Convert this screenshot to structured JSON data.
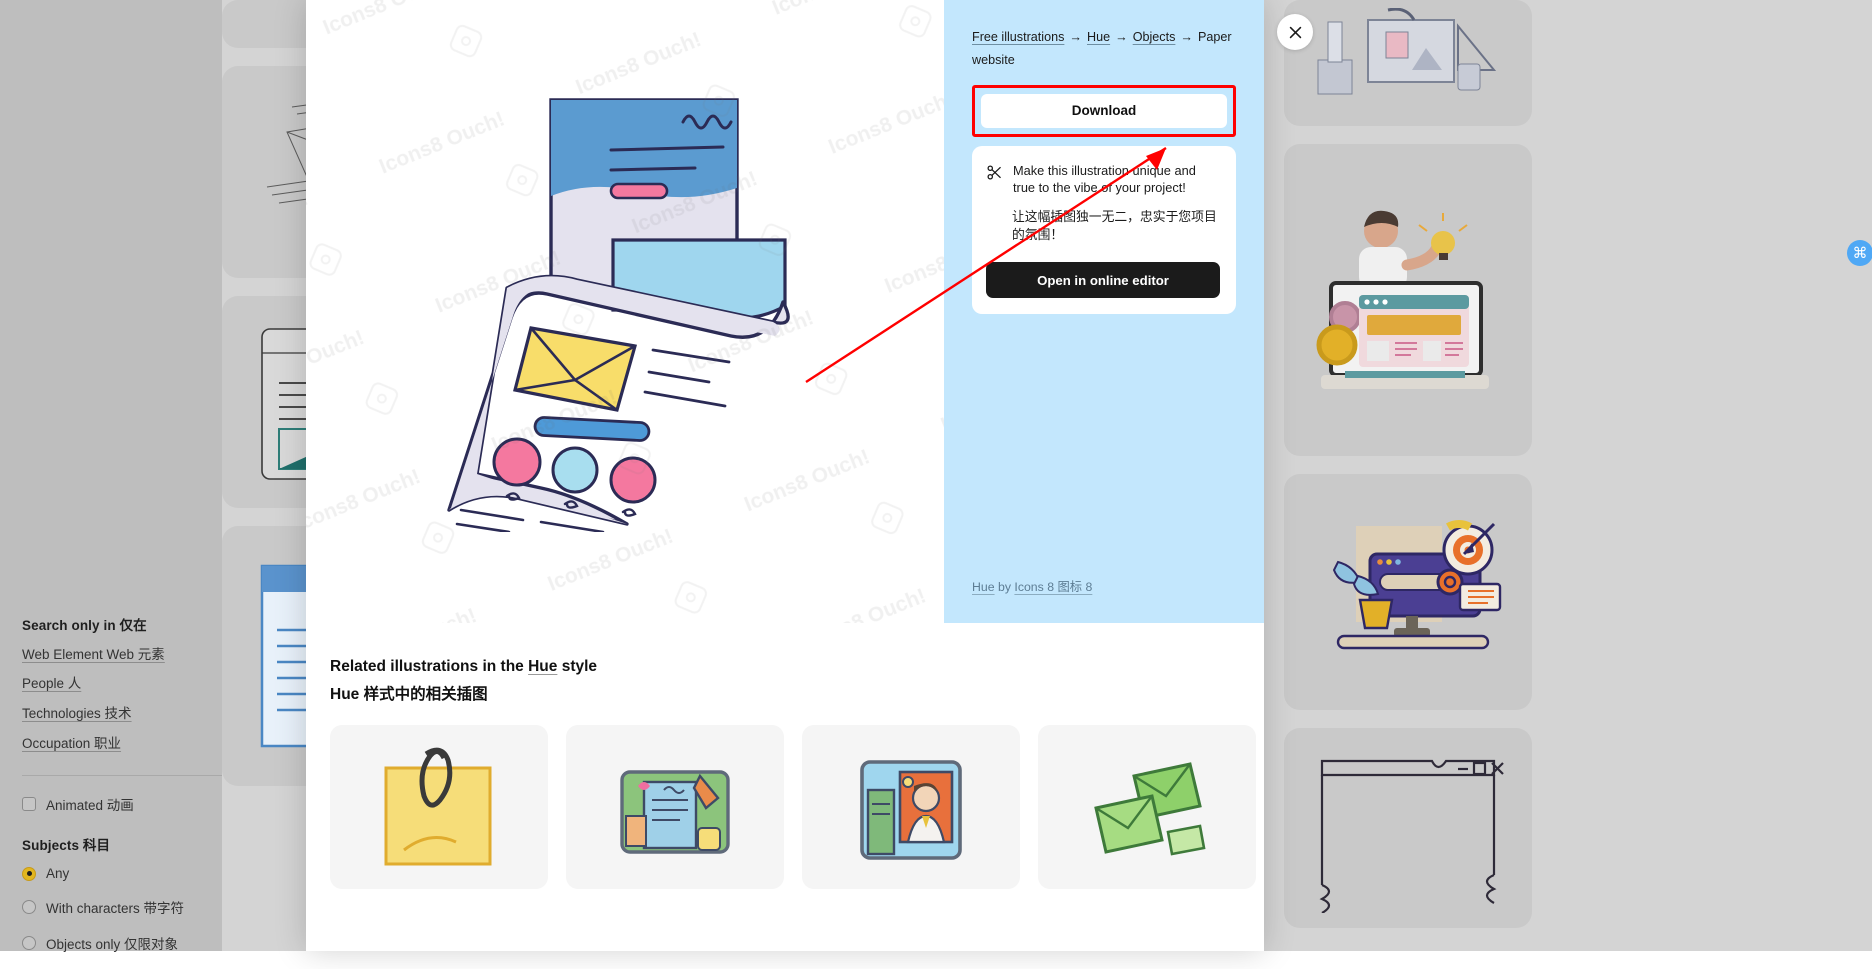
{
  "sidebar": {
    "search_only_heading": "Search only in 仅在",
    "links": [
      {
        "label": "Web Element Web 元素",
        "name": "filter-link-web-element"
      },
      {
        "label": "People 人",
        "name": "filter-link-people"
      },
      {
        "label": "Technologies 技术",
        "name": "filter-link-technologies"
      },
      {
        "label": "Occupation 职业",
        "name": "filter-link-occupation"
      }
    ],
    "animated_label": "Animated 动画",
    "animated_checked": false,
    "subjects_heading": "Subjects 科目",
    "subjects": [
      {
        "label": "Any",
        "selected": true
      },
      {
        "label": "With characters 带字符",
        "selected": false
      },
      {
        "label": "Objects only 仅限对象",
        "selected": false
      }
    ]
  },
  "modal": {
    "breadcrumb": {
      "items": [
        "Free illustrations",
        "Hue",
        "Objects"
      ],
      "separator": "→",
      "current": "Paper website"
    },
    "download_label": "Download",
    "promo": {
      "icon": "scissors-icon",
      "text_en": "Make this illustration unique and true to the vibe of your project!",
      "text_zh": "让这幅插图独一无二，忠实于您项目的氛围！",
      "button_label": "Open in online editor"
    },
    "attribution": {
      "style": "Hue",
      "by": "by",
      "author": "Icons 8 图标 8"
    },
    "illustration": {
      "name": "paper-website-illustration",
      "watermark": "Icons8 Ouch!"
    },
    "related": {
      "title_en_a": "Related illustrations in the ",
      "title_en_style": "Hue",
      "title_en_b": " style",
      "title_zh": "Hue 样式中的相关插图",
      "cards": [
        {
          "name": "related-card-sticky-note"
        },
        {
          "name": "related-card-tablet-notes"
        },
        {
          "name": "related-card-profile-screen"
        },
        {
          "name": "related-card-envelopes"
        }
      ]
    },
    "close_label": "×"
  },
  "overlay": {
    "annotation_color": "#ff0000",
    "cmd_badge": "⌘"
  },
  "background_cards": {
    "left": [
      {
        "name": "bg-card-envelope-sketch"
      },
      {
        "name": "bg-card-document-teal"
      },
      {
        "name": "bg-card-blue-page"
      }
    ],
    "right": [
      {
        "name": "bg-card-greyscale-studio"
      },
      {
        "name": "bg-card-laptop-idea"
      },
      {
        "name": "bg-card-target-search"
      },
      {
        "name": "bg-card-window-sketch"
      }
    ]
  },
  "colors": {
    "info_rail": "#c3e7fd",
    "accent_dark": "#1b1b1b",
    "annotation": "#ff0000",
    "page_dim": "#d4d4d4"
  }
}
